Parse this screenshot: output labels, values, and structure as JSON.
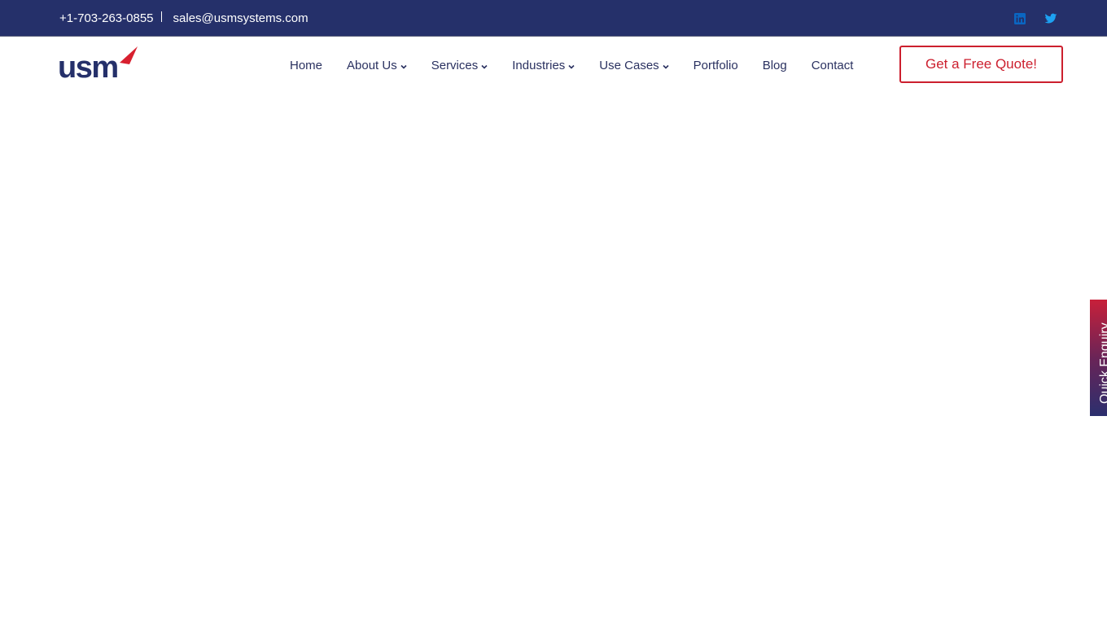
{
  "topbar": {
    "phone": "+1-703-263-0855",
    "email": "sales@usmsystems.com",
    "social": [
      {
        "name": "linkedin-icon",
        "color": "#0a66c2"
      },
      {
        "name": "twitter-icon",
        "color": "#1da1f2"
      }
    ],
    "background": "#25306a"
  },
  "header": {
    "logo_text": "usm",
    "nav": [
      {
        "label": "Home",
        "dropdown": false
      },
      {
        "label": "About Us",
        "dropdown": true
      },
      {
        "label": "Services",
        "dropdown": true
      },
      {
        "label": "Industries",
        "dropdown": true
      },
      {
        "label": "Use Cases",
        "dropdown": true
      },
      {
        "label": "Portfolio",
        "dropdown": false
      },
      {
        "label": "Blog",
        "dropdown": false
      },
      {
        "label": "Contact",
        "dropdown": false
      }
    ],
    "cta_label": "Get a Free Quote!",
    "cta_color": "#cc1f2e"
  },
  "quick_enquiry": {
    "label": "Quick Enquiry"
  }
}
